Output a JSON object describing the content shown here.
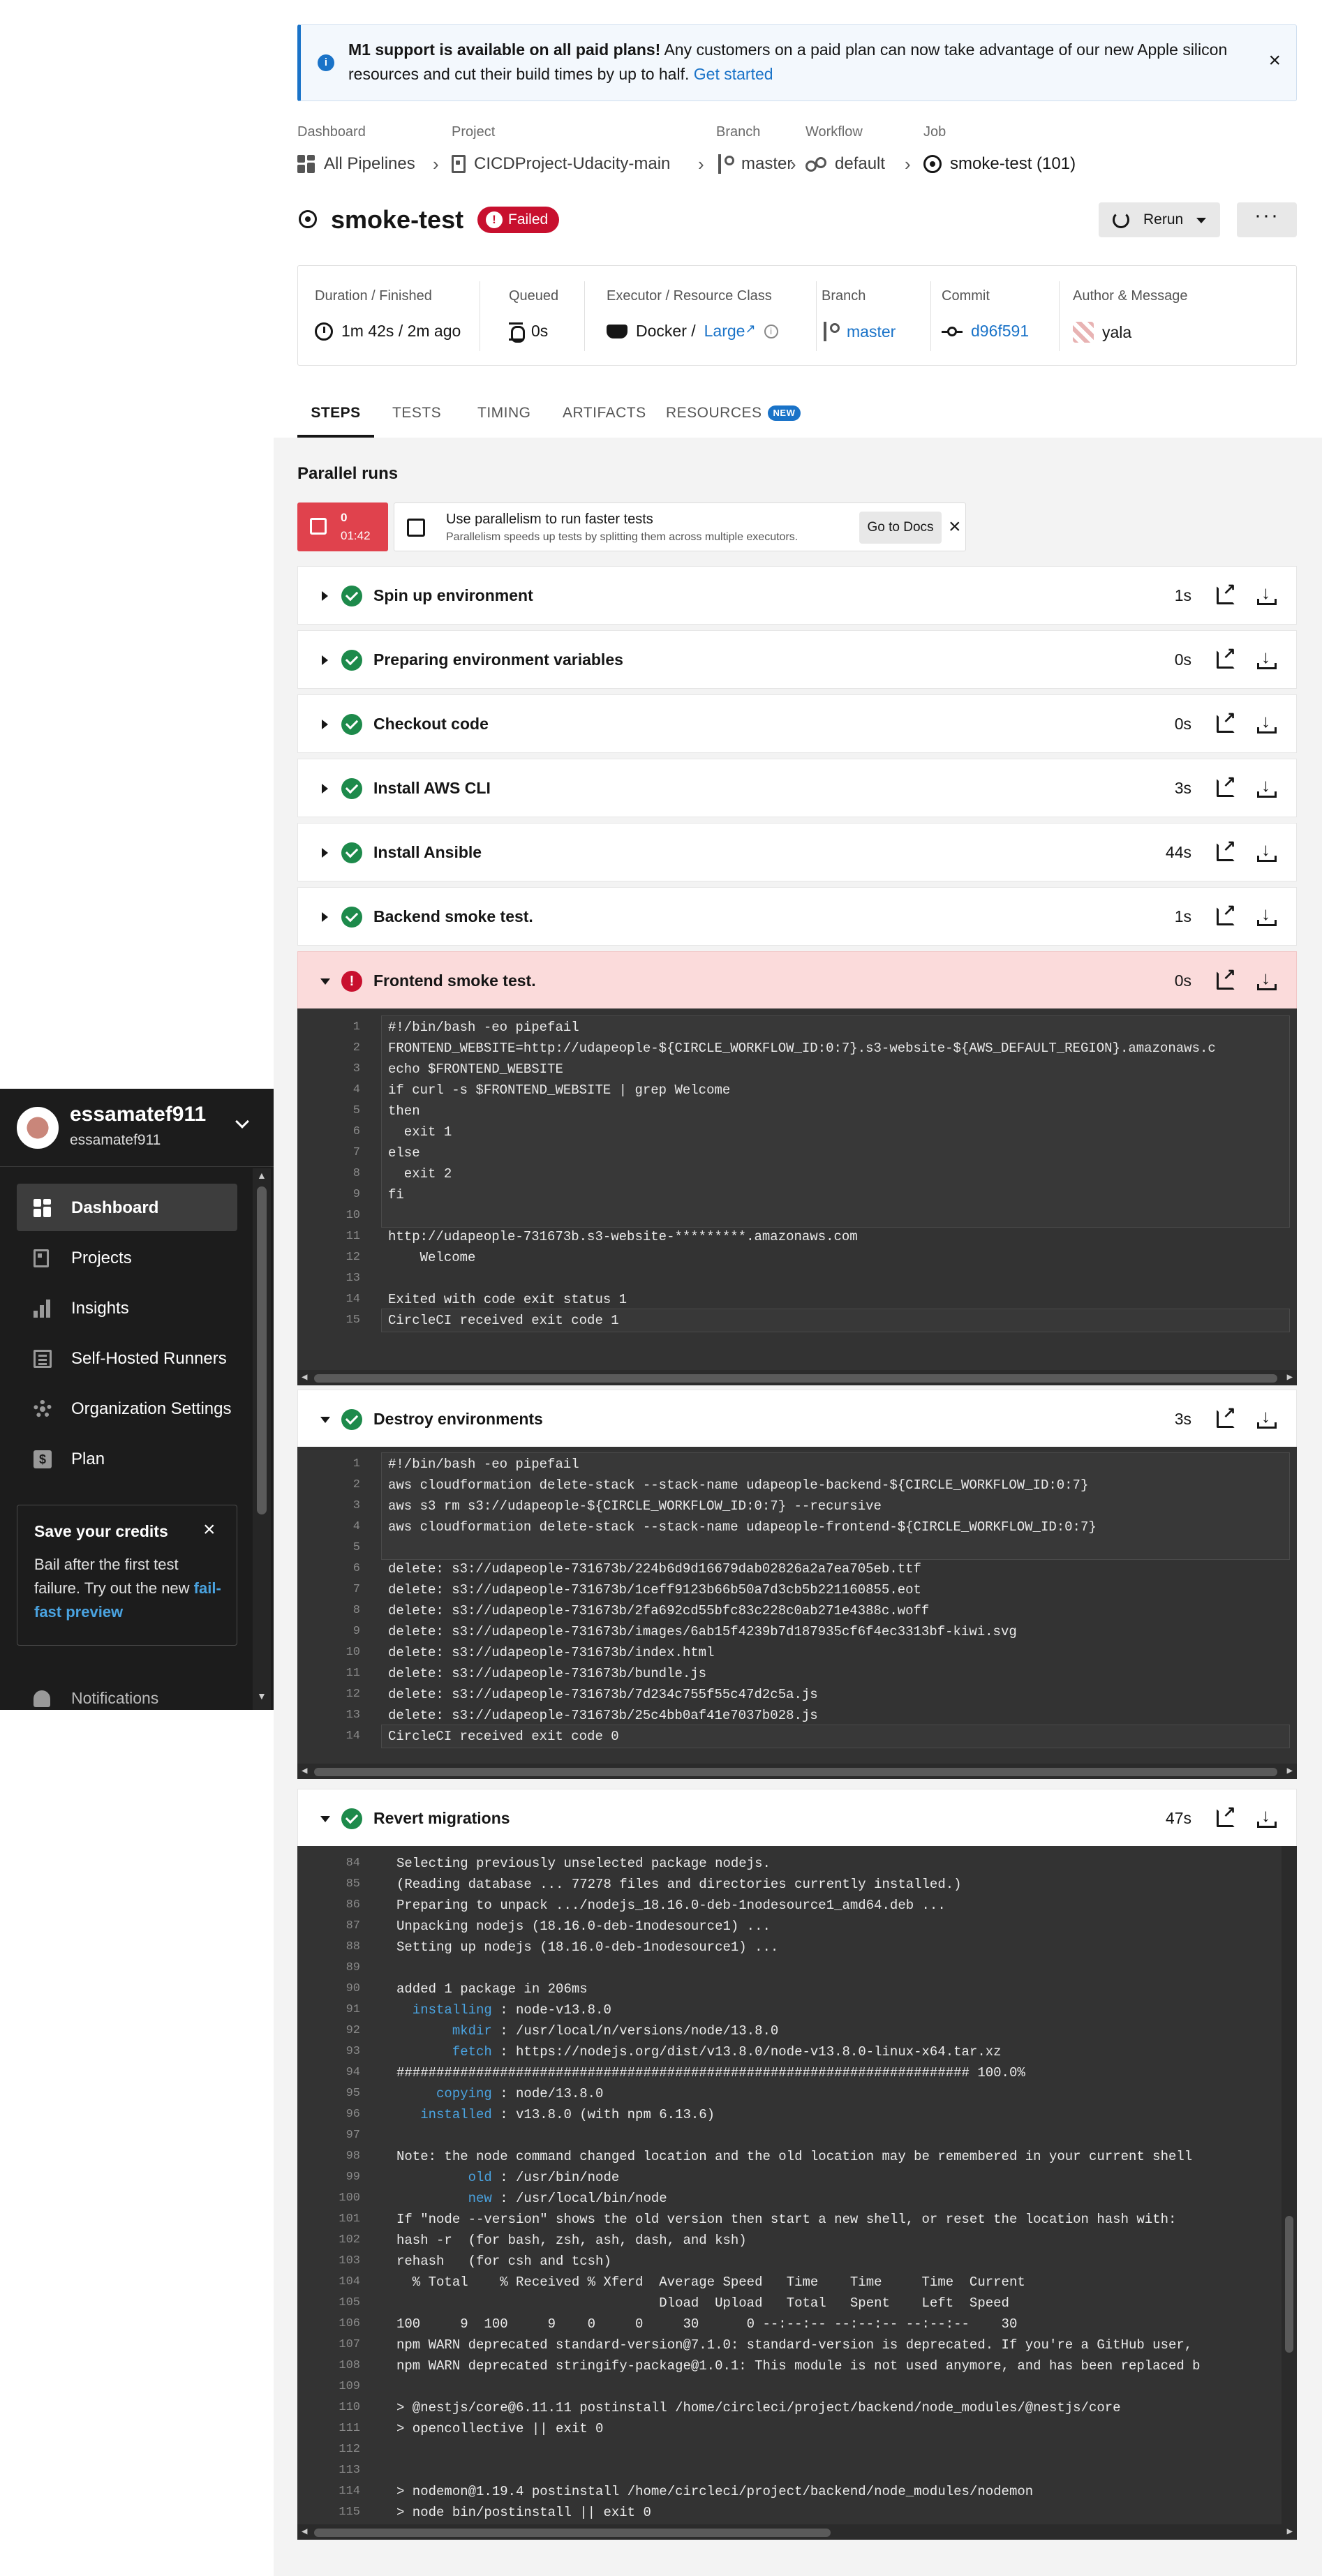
{
  "banner": {
    "bold": "M1 support is available on all paid plans!",
    "text": " Any customers on a paid plan can now take advantage of our new Apple silicon resources and cut their build times by up to half. ",
    "link": "Get started",
    "close": "×"
  },
  "breadcrumb": {
    "labels": {
      "dashboard": "Dashboard",
      "project": "Project",
      "branch": "Branch",
      "workflow": "Workflow",
      "job": "Job"
    },
    "values": {
      "dashboard": "All Pipelines",
      "project": "CICDProject-Udacity-main",
      "branch": "master",
      "workflow": "default",
      "job": "smoke-test (101)"
    },
    "separator": "›"
  },
  "job": {
    "title": "smoke-test",
    "status": "Failed",
    "rerun_label": "Rerun",
    "more_label": "···"
  },
  "meta": {
    "duration_label": "Duration / Finished",
    "duration_value": "1m 42s / 2m ago",
    "queued_label": "Queued",
    "queued_value": "0s",
    "executor_label": "Executor / Resource Class",
    "executor_value": "Docker /",
    "executor_class": "Large",
    "branch_label": "Branch",
    "branch_value": "master",
    "commit_label": "Commit",
    "commit_value": "d96f591",
    "author_label": "Author & Message",
    "author_value": "yala"
  },
  "tabs": [
    "STEPS",
    "TESTS",
    "TIMING",
    "ARTIFACTS",
    "RESOURCES"
  ],
  "tab_new_badge": "NEW",
  "parallel": {
    "title": "Parallel runs",
    "run_index": "0",
    "run_time": "01:42",
    "promo_title": "Use parallelism to run faster tests",
    "promo_sub": "Parallelism speeds up tests by splitting them across multiple executors.",
    "docs_button": "Go to Docs",
    "close": "×"
  },
  "steps": [
    {
      "name": "Spin up environment",
      "duration": "1s",
      "status": "success"
    },
    {
      "name": "Preparing environment variables",
      "duration": "0s",
      "status": "success"
    },
    {
      "name": "Checkout code",
      "duration": "0s",
      "status": "success"
    },
    {
      "name": "Install AWS CLI",
      "duration": "3s",
      "status": "success"
    },
    {
      "name": "Install Ansible",
      "duration": "44s",
      "status": "success"
    },
    {
      "name": "Backend smoke test.",
      "duration": "1s",
      "status": "success"
    },
    {
      "name": "Frontend smoke test.",
      "duration": "0s",
      "status": "failed"
    },
    {
      "name": "Destroy environments",
      "duration": "3s",
      "status": "success"
    },
    {
      "name": "Revert migrations",
      "duration": "47s",
      "status": "success"
    }
  ],
  "logs": {
    "frontend": [
      {
        "n": "1",
        "t": "#!/bin/bash -eo pipefail"
      },
      {
        "n": "2",
        "t": "FRONTEND_WEBSITE=http://udapeople-${CIRCLE_WORKFLOW_ID:0:7}.s3-website-${AWS_DEFAULT_REGION}.amazonaws.c"
      },
      {
        "n": "3",
        "t": "echo $FRONTEND_WEBSITE"
      },
      {
        "n": "4",
        "t": "if curl -s $FRONTEND_WEBSITE | grep Welcome"
      },
      {
        "n": "5",
        "t": "then"
      },
      {
        "n": "6",
        "t": "  exit 1"
      },
      {
        "n": "7",
        "t": "else"
      },
      {
        "n": "8",
        "t": "  exit 2"
      },
      {
        "n": "9",
        "t": "fi"
      },
      {
        "n": "10",
        "t": ""
      },
      {
        "n": "11",
        "t": "http://udapeople-731673b.s3-website-*********.amazonaws.com"
      },
      {
        "n": "12",
        "t": "    Welcome"
      },
      {
        "n": "13",
        "t": ""
      },
      {
        "n": "14",
        "t": "Exited with code exit status 1"
      },
      {
        "n": "15",
        "t": "CircleCI received exit code 1"
      }
    ],
    "destroy": [
      {
        "n": "1",
        "t": "#!/bin/bash -eo pipefail"
      },
      {
        "n": "2",
        "t": "aws cloudformation delete-stack --stack-name udapeople-backend-${CIRCLE_WORKFLOW_ID:0:7}"
      },
      {
        "n": "3",
        "t": "aws s3 rm s3://udapeople-${CIRCLE_WORKFLOW_ID:0:7} --recursive"
      },
      {
        "n": "4",
        "t": "aws cloudformation delete-stack --stack-name udapeople-frontend-${CIRCLE_WORKFLOW_ID:0:7}"
      },
      {
        "n": "5",
        "t": ""
      },
      {
        "n": "6",
        "t": "delete: s3://udapeople-731673b/224b6d9d16679dab02826a2a7ea705eb.ttf"
      },
      {
        "n": "7",
        "t": "delete: s3://udapeople-731673b/1ceff9123b66b50a7d3cb5b221160855.eot"
      },
      {
        "n": "8",
        "t": "delete: s3://udapeople-731673b/2fa692cd55bfc83c228c0ab271e4388c.woff"
      },
      {
        "n": "9",
        "t": "delete: s3://udapeople-731673b/images/6ab15f4239b7d187935cf6f4ec3313bf-kiwi.svg"
      },
      {
        "n": "10",
        "t": "delete: s3://udapeople-731673b/index.html"
      },
      {
        "n": "11",
        "t": "delete: s3://udapeople-731673b/bundle.js"
      },
      {
        "n": "12",
        "t": "delete: s3://udapeople-731673b/7d234c755f55c47d2c5a.js"
      },
      {
        "n": "13",
        "t": "delete: s3://udapeople-731673b/25c4bb0af41e7037b028.js"
      },
      {
        "n": "14",
        "t": "CircleCI received exit code 0"
      }
    ],
    "revert": [
      {
        "n": "84",
        "t": "Selecting previously unselected package nodejs."
      },
      {
        "n": "85",
        "t": "(Reading database ... 77278 files and directories currently installed.)"
      },
      {
        "n": "86",
        "t": "Preparing to unpack .../nodejs_18.16.0-deb-1nodesource1_amd64.deb ..."
      },
      {
        "n": "87",
        "t": "Unpacking nodejs (18.16.0-deb-1nodesource1) ..."
      },
      {
        "n": "88",
        "t": "Setting up nodejs (18.16.0-deb-1nodesource1) ..."
      },
      {
        "n": "89",
        "t": ""
      },
      {
        "n": "90",
        "t": "added 1 package in 206ms"
      },
      {
        "n": "91",
        "k": "  installing",
        "t": " : node-v13.8.0"
      },
      {
        "n": "92",
        "k": "       mkdir",
        "t": " : /usr/local/n/versions/node/13.8.0"
      },
      {
        "n": "93",
        "k": "       fetch",
        "t": " : https://nodejs.org/dist/v13.8.0/node-v13.8.0-linux-x64.tar.xz"
      },
      {
        "n": "94",
        "t": "######################################################################## 100.0%"
      },
      {
        "n": "95",
        "k": "     copying",
        "t": " : node/13.8.0"
      },
      {
        "n": "96",
        "k": "   installed",
        "t": " : v13.8.0 (with npm 6.13.6)"
      },
      {
        "n": "97",
        "t": ""
      },
      {
        "n": "98",
        "t": "Note: the node command changed location and the old location may be remembered in your current shell"
      },
      {
        "n": "99",
        "k": "         old",
        "t": " : /usr/bin/node"
      },
      {
        "n": "100",
        "k": "         new",
        "t": " : /usr/local/bin/node"
      },
      {
        "n": "101",
        "t": "If \"node --version\" shows the old version then start a new shell, or reset the location hash with:"
      },
      {
        "n": "102",
        "t": "hash -r  (for bash, zsh, ash, dash, and ksh)"
      },
      {
        "n": "103",
        "t": "rehash   (for csh and tcsh)"
      },
      {
        "n": "104",
        "t": "  % Total    % Received % Xferd  Average Speed   Time    Time     Time  Current"
      },
      {
        "n": "105",
        "t": "                                 Dload  Upload   Total   Spent    Left  Speed"
      },
      {
        "n": "106",
        "t": "100     9  100     9    0     0     30      0 --:--:-- --:--:-- --:--:--    30"
      },
      {
        "n": "107",
        "t": "npm WARN deprecated standard-version@7.1.0: standard-version is deprecated. If you're a GitHub user,"
      },
      {
        "n": "108",
        "t": "npm WARN deprecated stringify-package@1.0.1: This module is not used anymore, and has been replaced b"
      },
      {
        "n": "109",
        "t": ""
      },
      {
        "n": "110",
        "t": "> @nestjs/core@6.11.11 postinstall /home/circleci/project/backend/node_modules/@nestjs/core"
      },
      {
        "n": "111",
        "t": "> opencollective || exit 0"
      },
      {
        "n": "112",
        "t": ""
      },
      {
        "n": "113",
        "t": ""
      },
      {
        "n": "114",
        "t": "> nodemon@1.19.4 postinstall /home/circleci/project/backend/node_modules/nodemon"
      },
      {
        "n": "115",
        "t": "> node bin/postinstall || exit 0"
      }
    ]
  },
  "sidebar": {
    "user_name": "essamatef911",
    "user_sub": "essamatef911",
    "items": [
      {
        "label": "Dashboard",
        "icon": "dashboard-icon",
        "active": true
      },
      {
        "label": "Projects",
        "icon": "projects-icon"
      },
      {
        "label": "Insights",
        "icon": "insights-icon"
      },
      {
        "label": "Self-Hosted Runners",
        "icon": "runners-icon"
      },
      {
        "label": "Organization Settings",
        "icon": "gear-icon"
      },
      {
        "label": "Plan",
        "icon": "plan-icon"
      }
    ],
    "credits_title": "Save your credits",
    "credits_body": "Bail after the first test failure. Try out the new ",
    "credits_link": "fail-fast preview",
    "credits_close": "×",
    "notifications": "Notifications"
  },
  "colors": {
    "accent": "#1a73c8",
    "failed": "#c8102e",
    "success": "#1d8a4b",
    "failed_row": "#fbdbdb",
    "terminal_bg": "#333333",
    "sidebar_bg": "#1c1c1c"
  }
}
